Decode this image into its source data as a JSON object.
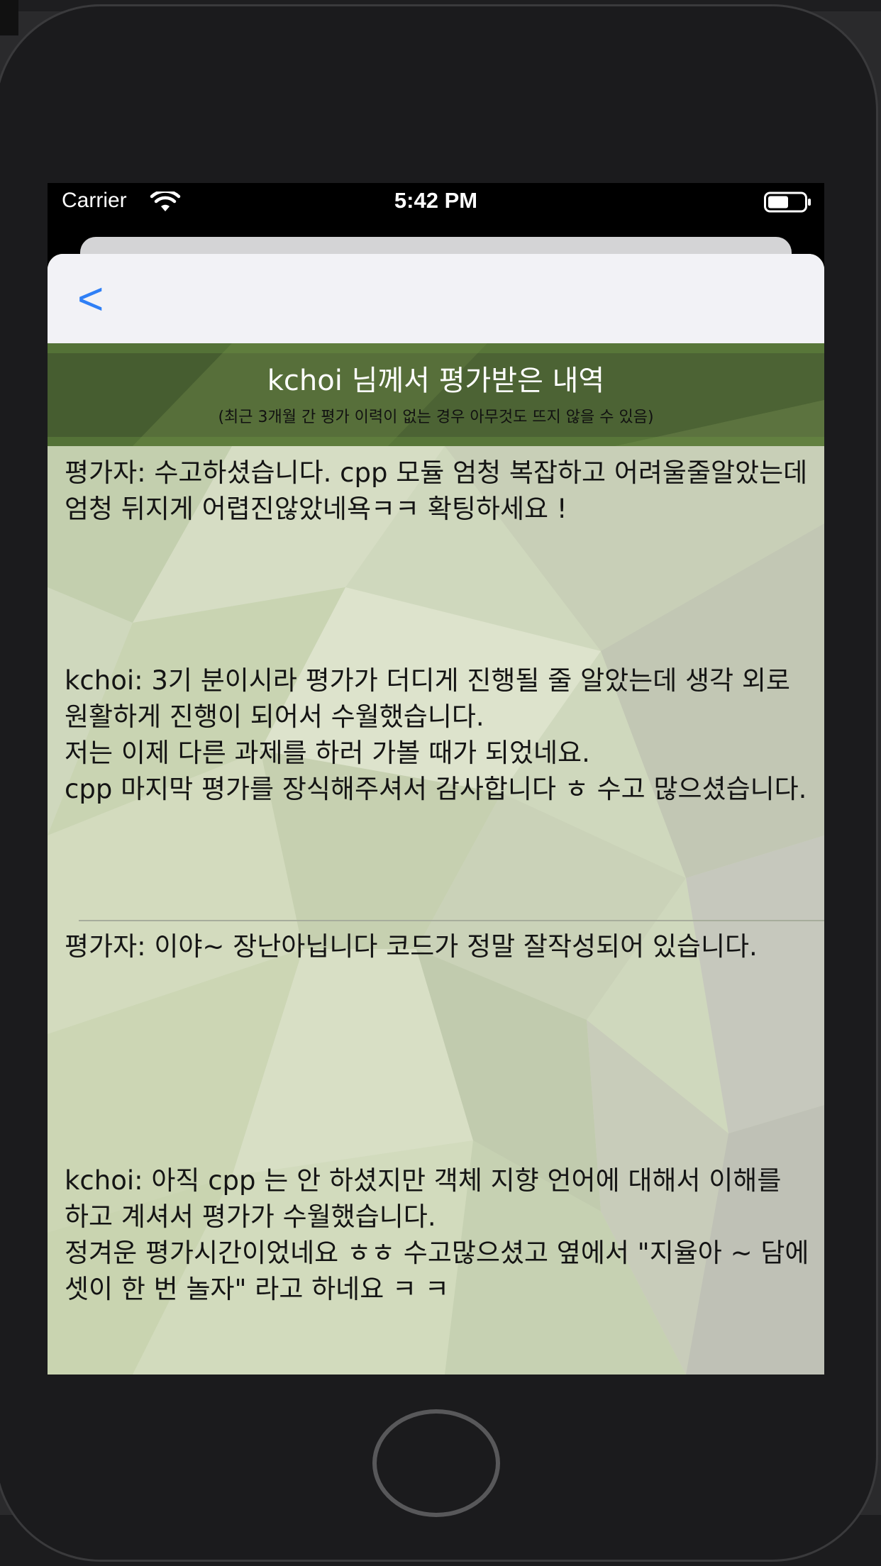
{
  "status_bar": {
    "carrier": "Carrier",
    "time": "5:42 PM",
    "wifi_icon": "wifi-icon",
    "battery_icon": "battery-icon"
  },
  "nav": {
    "back_label": "<"
  },
  "header": {
    "title": "kchoi 님께서 평가받은 내역",
    "subtitle": "(최근 3개월 간 평가 이력이 없는 경우 아무것도 뜨지 않을 수 있음)"
  },
  "entries": [
    {
      "evaluator_comment": "평가자:  수고하셨습니다.  cpp 모듈 엄청 복잡하고 어려울줄알았는데 엄청 뒤지게 어렵진않았네욕ㅋㅋ 확팅하세요 !",
      "evaluatee_comment": "kchoi:  3기 분이시라 평가가 더디게 진행될 줄 알았는데 생각 외로 원활하게 진행이 되어서 수월했습니다.\n저는 이제 다른 과제를 하러 가볼 때가 되었네요.\ncpp 마지막 평가를 장식해주셔서 감사합니다 ㅎ 수고 많으셨습니다."
    },
    {
      "evaluator_comment": "평가자:  이야~ 장난아닙니다 코드가 정말 잘작성되어 있습니다.",
      "evaluatee_comment": "kchoi:  아직 cpp 는 안 하셨지만 객체 지향 언어에 대해서 이해를 하고 계셔서 평가가 수월했습니다.\n정겨운 평가시간이었네요 ㅎㅎ 수고많으셨고 옆에서 \"지율아 ~ 담에 셋이 한 번 놀자\" 라고 하네요 ㅋ ㅋ"
    }
  ],
  "colors": {
    "accent": "#2f7ff6",
    "banner_green": "#5a7a3a",
    "content_bg": "#cfd8bd"
  }
}
